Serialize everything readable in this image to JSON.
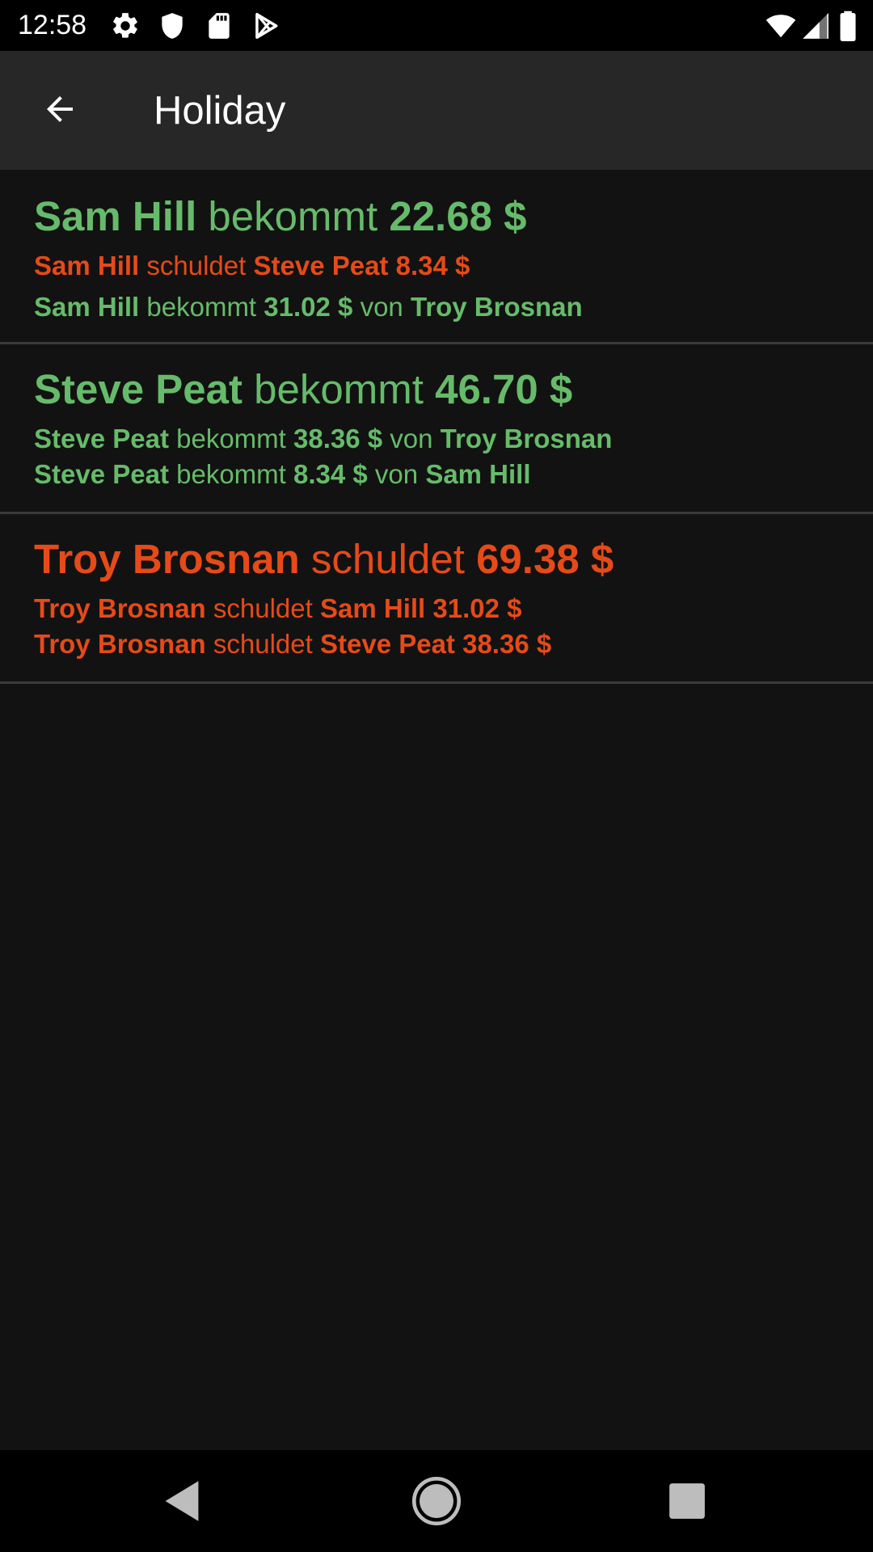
{
  "status_bar": {
    "time": "12:58",
    "left_icons": [
      "gear-icon",
      "shield-icon",
      "sd-card-icon",
      "play-store-icon"
    ],
    "right_icons": [
      "wifi-icon",
      "cell-signal-icon",
      "battery-icon"
    ]
  },
  "app_bar": {
    "title": "Holiday",
    "back_icon": "arrow-back-icon"
  },
  "colors": {
    "positive": "#66bb6a",
    "negative": "#e64a19",
    "background": "#121212",
    "app_bar": "#272727"
  },
  "balances": [
    {
      "status": "positive",
      "name": "Sam Hill",
      "verb": "bekommt",
      "amount": "22.68 $",
      "details": [
        {
          "status": "negative",
          "from": "Sam Hill",
          "verb": "schuldet",
          "to": "Steve Peat",
          "amount": "8.34 $"
        },
        {
          "status": "positive",
          "from": "Sam Hill",
          "verb": "bekommt",
          "amount": "31.02 $",
          "von": "von",
          "to": "Troy Brosnan"
        }
      ]
    },
    {
      "status": "positive",
      "name": "Steve Peat",
      "verb": "bekommt",
      "amount": "46.70 $",
      "details": [
        {
          "status": "positive",
          "from": "Steve Peat",
          "verb": "bekommt",
          "amount": "38.36 $",
          "von": "von",
          "to": "Troy Brosnan"
        },
        {
          "status": "positive",
          "from": "Steve Peat",
          "verb": "bekommt",
          "amount": "8.34 $",
          "von": "von",
          "to": "Sam Hill"
        }
      ]
    },
    {
      "status": "negative",
      "name": "Troy Brosnan",
      "verb": "schuldet",
      "amount": "69.38 $",
      "details": [
        {
          "status": "negative",
          "from": "Troy Brosnan",
          "verb": "schuldet",
          "to": "Sam Hill",
          "amount": "31.02 $"
        },
        {
          "status": "negative",
          "from": "Troy Brosnan",
          "verb": "schuldet",
          "to": "Steve Peat",
          "amount": "38.36 $"
        }
      ]
    }
  ],
  "nav_bar": {
    "buttons": [
      "back-triangle-icon",
      "home-circle-icon",
      "recents-square-icon"
    ]
  }
}
